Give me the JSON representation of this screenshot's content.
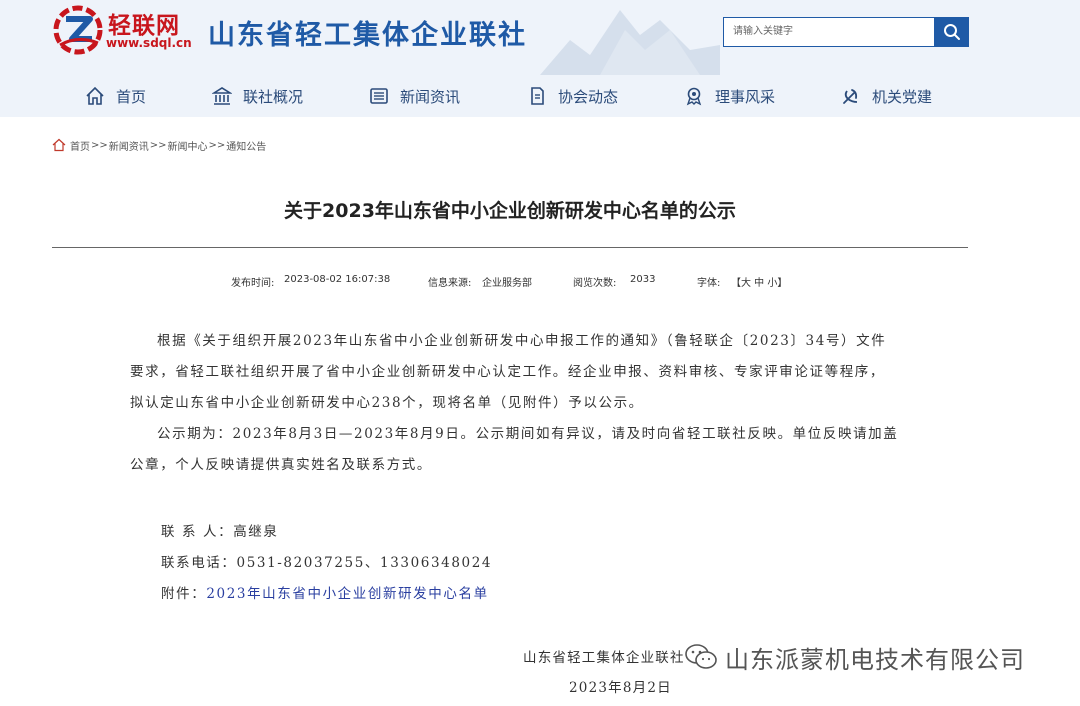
{
  "header": {
    "logo_name": "轻联网",
    "logo_url": "www.sdql.cn",
    "site_title": "山东省轻工集体企业联社",
    "search_placeholder": "请输入关键字",
    "search_icon": "search-icon"
  },
  "nav": [
    {
      "label": "首页",
      "icon": "home-icon"
    },
    {
      "label": "联社概况",
      "icon": "building-icon"
    },
    {
      "label": "新闻资讯",
      "icon": "news-icon"
    },
    {
      "label": "协会动态",
      "icon": "document-icon"
    },
    {
      "label": "理事风采",
      "icon": "medal-icon"
    },
    {
      "label": "机关党建",
      "icon": "party-emblem-icon"
    }
  ],
  "breadcrumb": {
    "items": [
      "首页",
      "新闻资讯",
      "新闻中心",
      "通知公告"
    ],
    "separator": ">>"
  },
  "article": {
    "title": "关于2023年山东省中小企业创新研发中心名单的公示",
    "meta": {
      "publish_label": "发布时间:",
      "publish_time": "2023-08-02 16:07:38",
      "source_label": "信息来源:",
      "source": "企业服务部",
      "views_label": "阅览次数:",
      "views": "2033",
      "font_label": "字体:",
      "font_options": "【大 中 小】"
    },
    "paragraph1": "根据《关于组织开展2023年山东省中小企业创新研发中心申报工作的通知》（鲁轻联企〔2023〕34号）文件要求，省轻工联社组织开展了省中小企业创新研发中心认定工作。经企业申报、资料审核、专家评审论证等程序，拟认定山东省中小企业创新研发中心238个，现将名单（见附件）予以公示。",
    "paragraph2": "公示期为：2023年8月3日—2023年8月9日。公示期间如有异议，请及时向省轻工联社反映。单位反映请加盖公章，个人反映请提供真实姓名及联系方式。",
    "contact_label": "联 系 人：",
    "contact_name": "高继泉",
    "phone_label": "联系电话：",
    "phone": "0531-82037255、13306348024",
    "attachment_label": "附件：",
    "attachment": "2023年山东省中小企业创新研发中心名单",
    "sign_org": "山东省轻工集体企业联社",
    "sign_date": "2023年8月2日"
  },
  "watermark": {
    "text": "山东派蒙机电技术有限公司",
    "icon": "wechat-icon"
  },
  "colors": {
    "brand_blue": "#1f5aa6",
    "brand_red": "#c8161d",
    "header_bg": "#eef3fa",
    "link_blue": "#2a3fa0"
  }
}
